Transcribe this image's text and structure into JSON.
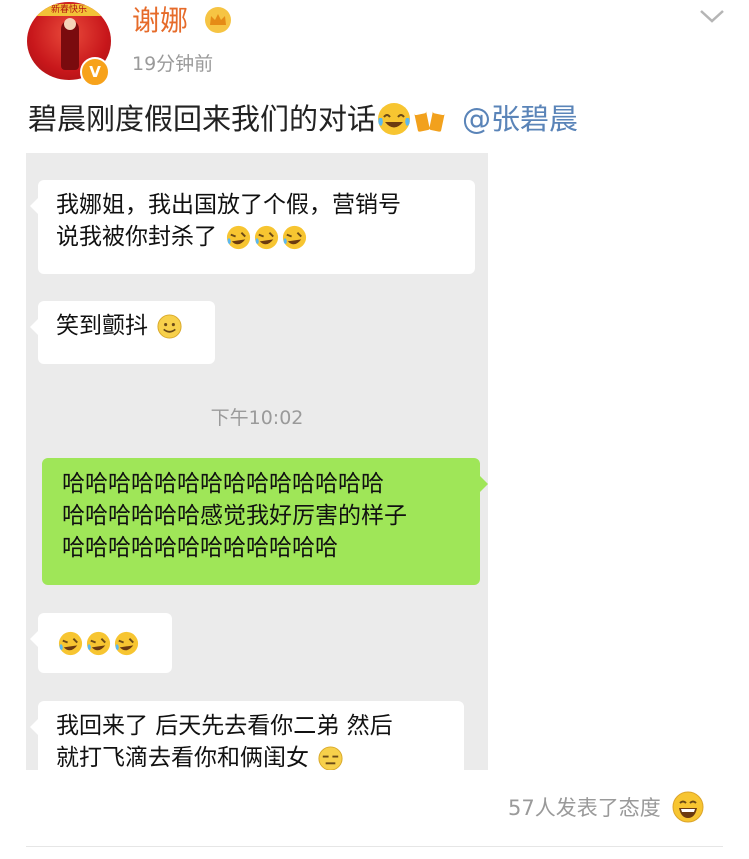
{
  "header": {
    "username": "谢娜",
    "timestamp": "19分钟前",
    "avatar_badge": "V",
    "avatar_banner": "新春快乐",
    "icons": [
      "crown-icon",
      "chevron-down-icon",
      "verified-badge-icon"
    ]
  },
  "post": {
    "text": "碧晨刚度假回来我们的对话",
    "emojis": [
      "tears-of-joy-emoji",
      "clinking-beers-emoji"
    ],
    "mention": "@张碧晨"
  },
  "chat": {
    "messages": [
      {
        "side": "left",
        "line1": "我娜姐，我出国放了个假，营销号",
        "line2": "说我被你封杀了",
        "emojis": [
          "rolling-laugh-emoji",
          "rolling-laugh-emoji",
          "rolling-laugh-emoji"
        ]
      },
      {
        "side": "left",
        "text": "笑到颤抖",
        "emojis": [
          "smile-emoji"
        ]
      },
      {
        "side": "right",
        "line1": "哈哈哈哈哈哈哈哈哈哈哈哈哈哈",
        "line2": "哈哈哈哈哈哈感觉我好厉害的样子",
        "line3": "哈哈哈哈哈哈哈哈哈哈哈哈"
      },
      {
        "side": "left",
        "emojis": [
          "rolling-laugh-emoji",
          "rolling-laugh-emoji",
          "rolling-laugh-emoji"
        ]
      },
      {
        "side": "left",
        "line1": "我回来了 后天先去看你二弟 然后",
        "line2": "就打飞滴去看你和俩闺女",
        "emojis": [
          "sly-emoji"
        ]
      }
    ],
    "time_divider": "下午10:02"
  },
  "footer": {
    "reactions_text": "57人发表了态度",
    "reaction_icon": "grinning-emoji"
  },
  "colors": {
    "username": "#e66b2a",
    "mention": "#5a84b8",
    "chat_bg": "#ebebeb",
    "bubble_right": "#9fe658",
    "badge": "#f7a21b"
  }
}
